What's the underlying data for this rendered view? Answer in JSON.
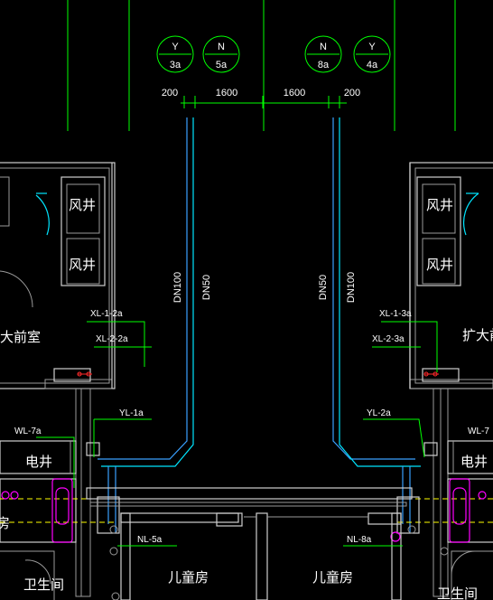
{
  "pipe_symbols": [
    {
      "letter": "Y",
      "number": "3a"
    },
    {
      "letter": "N",
      "number": "5a"
    },
    {
      "letter": "N",
      "number": "8a"
    },
    {
      "letter": "Y",
      "number": "4a"
    }
  ],
  "dimensions": [
    "200",
    "1600",
    "1600",
    "200"
  ],
  "pipe_sizes": {
    "left_a": "DN100",
    "left_b": "DN50",
    "right_a": "DN50",
    "right_b": "DN100"
  },
  "risers": {
    "xl_1_2a": "XL-1-2a",
    "xl_2_2a": "XL-2-2a",
    "xl_1_3a": "XL-1-3a",
    "xl_2_3a": "XL-2-3a",
    "yl_1a": "YL-1a",
    "yl_2a": "YL-2a",
    "wl_7a": "WL-7a",
    "wl_right": "WL-7",
    "nl_5a": "NL-5a",
    "nl_8a": "NL-8a"
  },
  "rooms": {
    "shaft_a": "风井",
    "shaft_b": "风井",
    "shaft_c": "风井",
    "shaft_d": "风井",
    "lobby_left": "大前室",
    "lobby_right": "扩大前",
    "elec_left": "电井",
    "elec_right": "电井",
    "kids_left": "儿童房",
    "kids_right": "儿童房",
    "bath_left": "卫生间",
    "bath_right": "卫生间",
    "edge_left": "房"
  },
  "colors": {
    "background": "#000000",
    "wall": "#cfcfcf",
    "grid": "#00ff00",
    "pipe_blue": "#3aa0ff",
    "pipe_cyan": "#00e5ff",
    "fixture": "#ff00ff",
    "hatch": "#ffff00",
    "text": "#ffffff"
  }
}
